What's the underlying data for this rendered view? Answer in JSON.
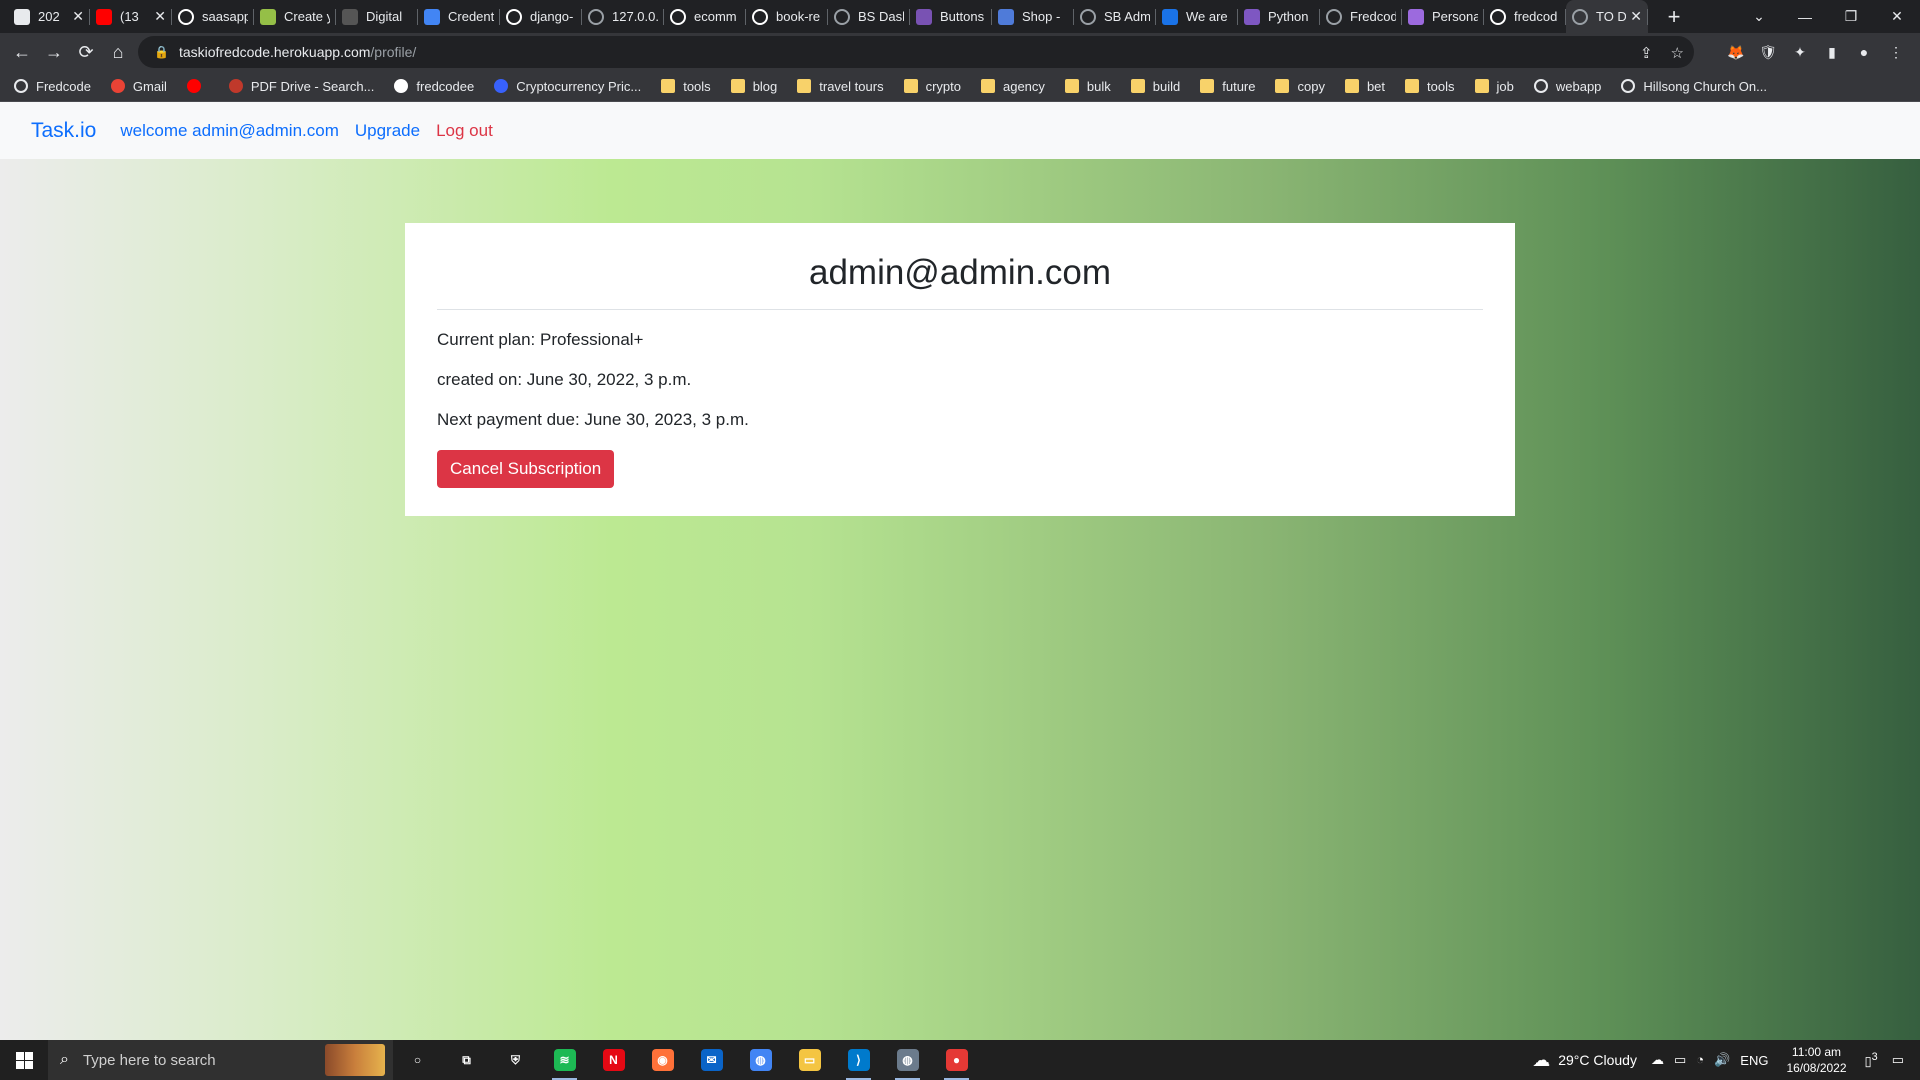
{
  "browser": {
    "tabs": [
      {
        "label": "202",
        "icon": "book-icon",
        "color": "#e8eaed",
        "closable": true
      },
      {
        "label": "(13",
        "icon": "youtube-icon",
        "color": "#ff0000",
        "closable": true
      },
      {
        "label": "saasapp",
        "icon": "github-icon",
        "color": "#ffffff"
      },
      {
        "label": "Create y",
        "icon": "shopify-icon",
        "color": "#95bf47"
      },
      {
        "label": "Digital",
        "icon": "s-icon",
        "color": "#555555"
      },
      {
        "label": "Credent",
        "icon": "api-icon",
        "color": "#4285f4"
      },
      {
        "label": "django-",
        "icon": "github-icon",
        "color": "#ffffff"
      },
      {
        "label": "127.0.0.",
        "icon": "globe-icon",
        "color": "#9aa0a6"
      },
      {
        "label": "ecomm",
        "icon": "github-icon",
        "color": "#ffffff"
      },
      {
        "label": "book-re",
        "icon": "github-icon",
        "color": "#ffffff"
      },
      {
        "label": "BS Dash",
        "icon": "globe-icon",
        "color": "#9aa0a6"
      },
      {
        "label": "Buttons",
        "icon": "bootstrap-icon",
        "color": "#7952b3"
      },
      {
        "label": "Shop - ",
        "icon": "flag-icon",
        "color": "#4f7bd9"
      },
      {
        "label": "SB Adm",
        "icon": "globe-icon",
        "color": "#9aa0a6"
      },
      {
        "label": "We are",
        "icon": "p-icon",
        "color": "#1a73e8"
      },
      {
        "label": "Python",
        "icon": "list-icon",
        "color": "#7e57c2"
      },
      {
        "label": "Fredcod",
        "icon": "globe-icon",
        "color": "#9aa0a6"
      },
      {
        "label": "Persona",
        "icon": "h-icon",
        "color": "#9c6ade"
      },
      {
        "label": "fredcod",
        "icon": "github-icon",
        "color": "#ffffff"
      },
      {
        "label": "TO D",
        "icon": "globe-icon",
        "color": "#9aa0a6",
        "active": true,
        "closable": true
      }
    ],
    "new_tab": "+",
    "window_controls": {
      "tabsearch": "⌄",
      "minimize": "—",
      "restore": "❐",
      "close": "✕"
    },
    "nav": {
      "back": "←",
      "forward": "→",
      "reload": "⟳",
      "home": "⌂"
    },
    "url_host": "taskiofredcode.herokuapp.com",
    "url_path": "/profile/",
    "lock": "🔒",
    "omnibox_icons": {
      "share": "⇪",
      "star": "☆"
    },
    "extensions": [
      {
        "name": "metamask-icon",
        "glyph": "🦊"
      },
      {
        "name": "vpn-icon",
        "glyph": "🛡"
      },
      {
        "name": "puzzle-icon",
        "glyph": "✦"
      },
      {
        "name": "sidepanel-icon",
        "glyph": "▮"
      },
      {
        "name": "profile-avatar-icon",
        "glyph": "●"
      },
      {
        "name": "menu-kebab-icon",
        "glyph": "⋮"
      }
    ],
    "bookmarks": [
      {
        "label": "Fredcode",
        "type": "globe",
        "color": "#e8eaed"
      },
      {
        "label": "Gmail",
        "type": "gmail",
        "color": "#ea4335"
      },
      {
        "label": "",
        "type": "youtube",
        "color": "#ff0000"
      },
      {
        "label": "PDF Drive - Search...",
        "type": "pdf",
        "color": "#c0392b"
      },
      {
        "label": "fredcodee",
        "type": "github",
        "color": "#ffffff"
      },
      {
        "label": "Cryptocurrency Pric...",
        "type": "crypto",
        "color": "#3861fb"
      },
      {
        "label": "tools",
        "type": "folder"
      },
      {
        "label": "blog",
        "type": "folder"
      },
      {
        "label": "travel tours",
        "type": "folder"
      },
      {
        "label": "crypto",
        "type": "folder"
      },
      {
        "label": "agency",
        "type": "folder"
      },
      {
        "label": "bulk",
        "type": "folder"
      },
      {
        "label": "build",
        "type": "folder"
      },
      {
        "label": "future",
        "type": "folder"
      },
      {
        "label": "copy",
        "type": "folder"
      },
      {
        "label": "bet",
        "type": "folder"
      },
      {
        "label": "tools",
        "type": "folder"
      },
      {
        "label": "job",
        "type": "folder"
      },
      {
        "label": "webapp",
        "type": "globe",
        "color": "#e8eaed"
      },
      {
        "label": "Hillsong Church On...",
        "type": "globe",
        "color": "#e8eaed"
      }
    ]
  },
  "app": {
    "brand": "Task.io",
    "welcome": "welcome admin@admin.com",
    "upgrade": "Upgrade",
    "logout": "Log out",
    "colors": {
      "link": "#0d6efd",
      "danger": "#dc3545"
    }
  },
  "profile": {
    "email": "admin@admin.com",
    "current_plan": "Current plan: Professional+",
    "created_on": "created on: June 30, 2022, 3 p.m.",
    "next_payment": "Next payment due: June 30, 2023, 3 p.m.",
    "cancel_label": "Cancel Subscription"
  },
  "taskbar": {
    "search_placeholder": "Type here to search",
    "apps": [
      {
        "name": "cortana-icon",
        "glyph": "○",
        "color": "transparent"
      },
      {
        "name": "task-view-icon",
        "glyph": "⧉",
        "color": "transparent"
      },
      {
        "name": "security-icon",
        "glyph": "⛨",
        "color": "transparent"
      },
      {
        "name": "spotify-icon",
        "glyph": "≋",
        "color": "#1db954",
        "run": true
      },
      {
        "name": "netflix-icon",
        "glyph": "N",
        "color": "#e50914"
      },
      {
        "name": "firefox-icon",
        "glyph": "◉",
        "color": "#ff7139"
      },
      {
        "name": "mail-icon",
        "glyph": "✉",
        "color": "#0a64c8"
      },
      {
        "name": "chrome-icon",
        "glyph": "◍",
        "color": "#4285f4"
      },
      {
        "name": "file-explorer-icon",
        "glyph": "▭",
        "color": "#f4c542"
      },
      {
        "name": "vscode-icon",
        "glyph": "⟩",
        "color": "#007acc",
        "run": true
      },
      {
        "name": "chrome-profile-icon",
        "glyph": "◍",
        "color": "#6b7b8c",
        "run": true
      },
      {
        "name": "recorder-icon",
        "glyph": "●",
        "color": "#e53935",
        "run": true
      }
    ],
    "weather": "29°C  Cloudy",
    "tray": [
      "☁",
      "▭",
      "◔",
      "🔊"
    ],
    "lang": "ENG",
    "time": "11:00 am",
    "date": "16/08/2022",
    "notifications": "3"
  }
}
